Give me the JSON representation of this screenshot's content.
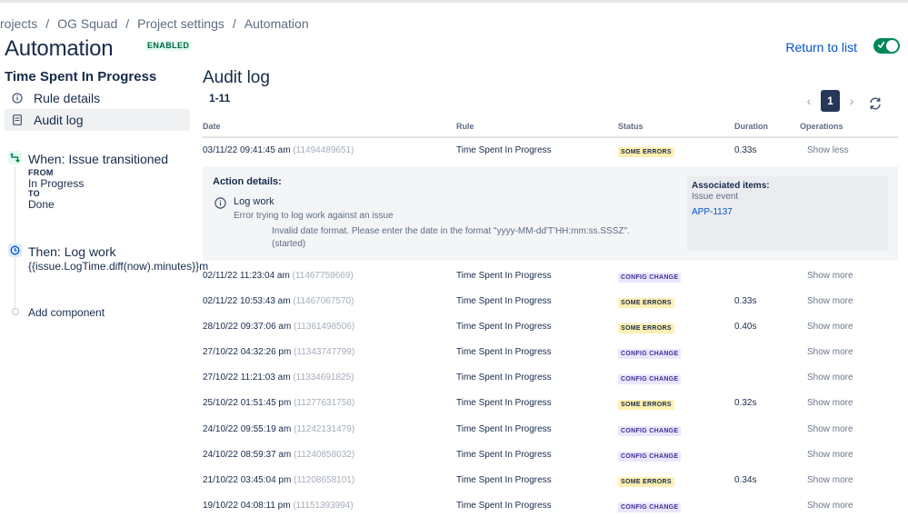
{
  "breadcrumb": [
    "rojects",
    "OG Squad",
    "Project settings",
    "Automation"
  ],
  "breadcrumb_sep": "/",
  "header": {
    "title": "Automation",
    "badge": "ENABLED",
    "return_link": "Return to list",
    "toggle_on": true
  },
  "sidebar": {
    "rule_name": "Time Spent In Progress",
    "items": [
      {
        "label": "Rule details",
        "icon": "info-icon",
        "active": false
      },
      {
        "label": "Audit log",
        "icon": "document-icon",
        "active": true
      }
    ],
    "trigger": {
      "title": "When: Issue transitioned",
      "from_label": "FROM",
      "from_value": "In Progress",
      "to_label": "TO",
      "to_value": "Done"
    },
    "action": {
      "title": "Then: Log work",
      "value": "{{issue.LogTime.diff(now).minutes}}m"
    },
    "add_component": "Add component"
  },
  "audit": {
    "title": "Audit log",
    "count": "1-11",
    "current_page": "1",
    "columns": [
      "Date",
      "Rule",
      "Status",
      "Duration",
      "Operations"
    ],
    "expanded": {
      "heading": "Action details:",
      "action_title": "Log work",
      "action_message": "Invalid date format. Please enter the date in the format \"yyyy-MM-dd'T'HH:mm:ss.SSSZ\". (started)",
      "action_error": "Error trying to log work against an issue",
      "assoc_title": "Associated items:",
      "assoc_sub": "Issue event",
      "assoc_link": "APP-1137"
    },
    "rows": [
      {
        "date": "03/11/22 09:41:45 am",
        "id": "(11494489651)",
        "rule": "Time Spent In Progress",
        "status": "SOME ERRORS",
        "duration": "0.33s",
        "op": "Show less"
      },
      {
        "date": "02/11/22 11:23:04 am",
        "id": "(11467759669)",
        "rule": "Time Spent In Progress",
        "status": "CONFIG CHANGE",
        "duration": "",
        "op": "Show more"
      },
      {
        "date": "02/11/22 10:53:43 am",
        "id": "(11467067570)",
        "rule": "Time Spent In Progress",
        "status": "SOME ERRORS",
        "duration": "0.33s",
        "op": "Show more"
      },
      {
        "date": "28/10/22 09:37:06 am",
        "id": "(11361498506)",
        "rule": "Time Spent In Progress",
        "status": "SOME ERRORS",
        "duration": "0.40s",
        "op": "Show more"
      },
      {
        "date": "27/10/22 04:32:26 pm",
        "id": "(11343747799)",
        "rule": "Time Spent In Progress",
        "status": "CONFIG CHANGE",
        "duration": "",
        "op": "Show more"
      },
      {
        "date": "27/10/22 11:21:03 am",
        "id": "(11334691825)",
        "rule": "Time Spent In Progress",
        "status": "CONFIG CHANGE",
        "duration": "",
        "op": "Show more"
      },
      {
        "date": "25/10/22 01:51:45 pm",
        "id": "(11277631758)",
        "rule": "Time Spent In Progress",
        "status": "SOME ERRORS",
        "duration": "0.32s",
        "op": "Show more"
      },
      {
        "date": "24/10/22 09:55:19 am",
        "id": "(11242131479)",
        "rule": "Time Spent In Progress",
        "status": "CONFIG CHANGE",
        "duration": "",
        "op": "Show more"
      },
      {
        "date": "24/10/22 08:59:37 am",
        "id": "(11240858032)",
        "rule": "Time Spent In Progress",
        "status": "CONFIG CHANGE",
        "duration": "",
        "op": "Show more"
      },
      {
        "date": "21/10/22 03:45:04 pm",
        "id": "(11208658101)",
        "rule": "Time Spent In Progress",
        "status": "SOME ERRORS",
        "duration": "0.34s",
        "op": "Show more"
      },
      {
        "date": "19/10/22 04:08:11 pm",
        "id": "(11151393994)",
        "rule": "Time Spent In Progress",
        "status": "CONFIG CHANGE",
        "duration": "",
        "op": "Show more"
      }
    ]
  },
  "colors": {
    "accent": "#0052cc",
    "enabled": "#00875a",
    "error_bg": "#fff0b3",
    "config_bg": "#eae6ff"
  }
}
